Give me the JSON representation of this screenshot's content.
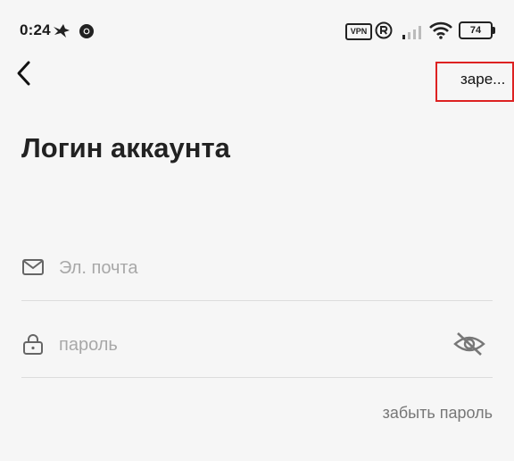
{
  "status_bar": {
    "time": "0:24",
    "vpn_label": "VPN",
    "battery_level": "74",
    "icons": [
      "bird-icon",
      "chrome-icon",
      "vpn-icon",
      "registered-icon",
      "signal-icon",
      "wifi-icon",
      "battery-icon"
    ]
  },
  "header": {
    "back_icon": "chevron-left-icon",
    "register_label": "заре..."
  },
  "title": "Логин аккаунта",
  "form": {
    "email": {
      "placeholder": "Эл. почта",
      "value": "",
      "icon": "mail-icon"
    },
    "password": {
      "placeholder": "пароль",
      "value": "",
      "icon": "lock-icon",
      "toggle_icon": "eye-off-icon"
    },
    "forgot_label": "забыть пароль"
  },
  "colors": {
    "background": "#f6f6f6",
    "highlight_border": "#dd2222",
    "placeholder": "#a8a8a8",
    "link": "#777777"
  }
}
